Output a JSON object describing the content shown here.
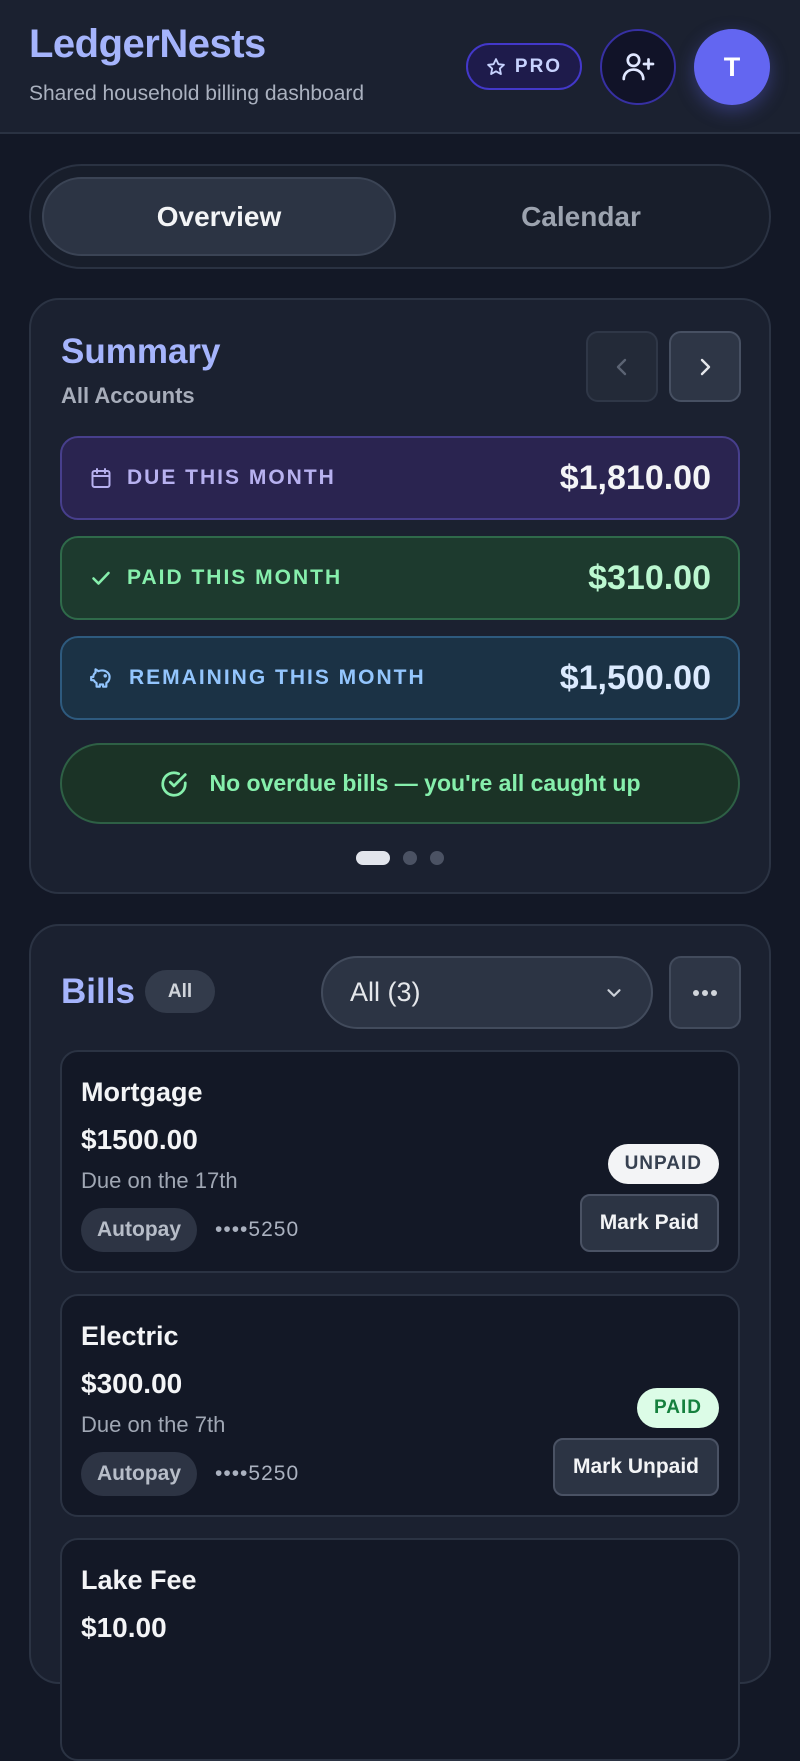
{
  "header": {
    "title": "LedgerNests",
    "subtitle": "Shared household billing dashboard",
    "pro_label": "PRO",
    "avatar_initial": "T",
    "icons": {
      "pro": "star-icon",
      "add_member": "user-plus-icon"
    }
  },
  "tabs": [
    {
      "label": "Overview",
      "active": true
    },
    {
      "label": "Calendar",
      "active": false
    }
  ],
  "summary": {
    "title": "Summary",
    "subtitle": "All Accounts",
    "stats": [
      {
        "label": "DUE THIS MONTH",
        "amount": "$1,810.00",
        "icon": "calendar-icon"
      },
      {
        "label": "PAID THIS MONTH",
        "amount": "$310.00",
        "icon": "check-icon"
      },
      {
        "label": "REMAINING THIS MONTH",
        "amount": "$1,500.00",
        "icon": "piggy-bank-icon"
      }
    ],
    "status_message": "No overdue bills — you're all caught up",
    "carousel": {
      "total_pages": 3,
      "active_page": 1
    }
  },
  "bills": {
    "title": "Bills",
    "chip": "All",
    "filter_value": "All (3)",
    "items": [
      {
        "name": "Mortgage",
        "amount": "$1500.00",
        "due": "Due on the 17th",
        "autopay": "Autopay",
        "account": "••••5250",
        "status": "UNPAID",
        "action": "Mark Paid"
      },
      {
        "name": "Electric",
        "amount": "$300.00",
        "due": "Due on the 7th",
        "autopay": "Autopay",
        "account": "••••5250",
        "status": "PAID",
        "action": "Mark Unpaid"
      },
      {
        "name": "Lake Fee",
        "amount": "$10.00"
      }
    ]
  },
  "colors": {
    "accent": "#6366f1",
    "title": "#a5b4fc",
    "paid": "#86efac",
    "due": "#b7b1f0",
    "remaining": "#93c5fd",
    "background": "#131826"
  }
}
